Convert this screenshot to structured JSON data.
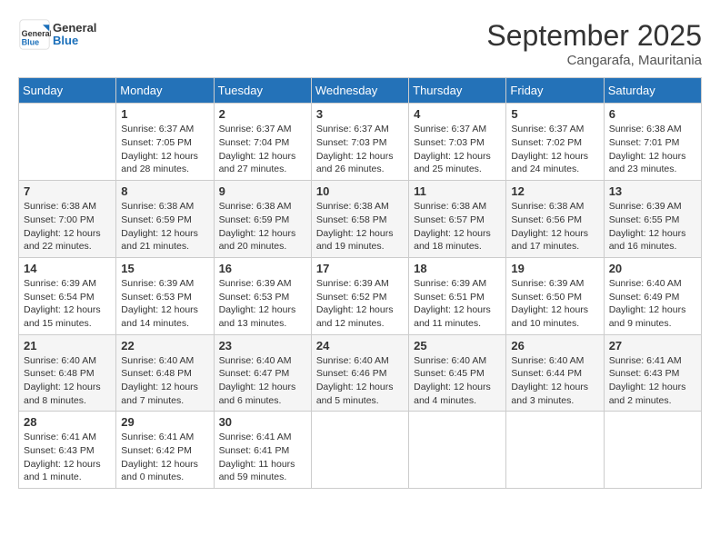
{
  "header": {
    "logo_general": "General",
    "logo_blue": "Blue",
    "month_year": "September 2025",
    "location": "Cangarafa, Mauritania"
  },
  "days_of_week": [
    "Sunday",
    "Monday",
    "Tuesday",
    "Wednesday",
    "Thursday",
    "Friday",
    "Saturday"
  ],
  "weeks": [
    [
      {
        "day": "",
        "info": ""
      },
      {
        "day": "1",
        "info": "Sunrise: 6:37 AM\nSunset: 7:05 PM\nDaylight: 12 hours\nand 28 minutes."
      },
      {
        "day": "2",
        "info": "Sunrise: 6:37 AM\nSunset: 7:04 PM\nDaylight: 12 hours\nand 27 minutes."
      },
      {
        "day": "3",
        "info": "Sunrise: 6:37 AM\nSunset: 7:03 PM\nDaylight: 12 hours\nand 26 minutes."
      },
      {
        "day": "4",
        "info": "Sunrise: 6:37 AM\nSunset: 7:03 PM\nDaylight: 12 hours\nand 25 minutes."
      },
      {
        "day": "5",
        "info": "Sunrise: 6:37 AM\nSunset: 7:02 PM\nDaylight: 12 hours\nand 24 minutes."
      },
      {
        "day": "6",
        "info": "Sunrise: 6:38 AM\nSunset: 7:01 PM\nDaylight: 12 hours\nand 23 minutes."
      }
    ],
    [
      {
        "day": "7",
        "info": "Sunrise: 6:38 AM\nSunset: 7:00 PM\nDaylight: 12 hours\nand 22 minutes."
      },
      {
        "day": "8",
        "info": "Sunrise: 6:38 AM\nSunset: 6:59 PM\nDaylight: 12 hours\nand 21 minutes."
      },
      {
        "day": "9",
        "info": "Sunrise: 6:38 AM\nSunset: 6:59 PM\nDaylight: 12 hours\nand 20 minutes."
      },
      {
        "day": "10",
        "info": "Sunrise: 6:38 AM\nSunset: 6:58 PM\nDaylight: 12 hours\nand 19 minutes."
      },
      {
        "day": "11",
        "info": "Sunrise: 6:38 AM\nSunset: 6:57 PM\nDaylight: 12 hours\nand 18 minutes."
      },
      {
        "day": "12",
        "info": "Sunrise: 6:38 AM\nSunset: 6:56 PM\nDaylight: 12 hours\nand 17 minutes."
      },
      {
        "day": "13",
        "info": "Sunrise: 6:39 AM\nSunset: 6:55 PM\nDaylight: 12 hours\nand 16 minutes."
      }
    ],
    [
      {
        "day": "14",
        "info": "Sunrise: 6:39 AM\nSunset: 6:54 PM\nDaylight: 12 hours\nand 15 minutes."
      },
      {
        "day": "15",
        "info": "Sunrise: 6:39 AM\nSunset: 6:53 PM\nDaylight: 12 hours\nand 14 minutes."
      },
      {
        "day": "16",
        "info": "Sunrise: 6:39 AM\nSunset: 6:53 PM\nDaylight: 12 hours\nand 13 minutes."
      },
      {
        "day": "17",
        "info": "Sunrise: 6:39 AM\nSunset: 6:52 PM\nDaylight: 12 hours\nand 12 minutes."
      },
      {
        "day": "18",
        "info": "Sunrise: 6:39 AM\nSunset: 6:51 PM\nDaylight: 12 hours\nand 11 minutes."
      },
      {
        "day": "19",
        "info": "Sunrise: 6:39 AM\nSunset: 6:50 PM\nDaylight: 12 hours\nand 10 minutes."
      },
      {
        "day": "20",
        "info": "Sunrise: 6:40 AM\nSunset: 6:49 PM\nDaylight: 12 hours\nand 9 minutes."
      }
    ],
    [
      {
        "day": "21",
        "info": "Sunrise: 6:40 AM\nSunset: 6:48 PM\nDaylight: 12 hours\nand 8 minutes."
      },
      {
        "day": "22",
        "info": "Sunrise: 6:40 AM\nSunset: 6:48 PM\nDaylight: 12 hours\nand 7 minutes."
      },
      {
        "day": "23",
        "info": "Sunrise: 6:40 AM\nSunset: 6:47 PM\nDaylight: 12 hours\nand 6 minutes."
      },
      {
        "day": "24",
        "info": "Sunrise: 6:40 AM\nSunset: 6:46 PM\nDaylight: 12 hours\nand 5 minutes."
      },
      {
        "day": "25",
        "info": "Sunrise: 6:40 AM\nSunset: 6:45 PM\nDaylight: 12 hours\nand 4 minutes."
      },
      {
        "day": "26",
        "info": "Sunrise: 6:40 AM\nSunset: 6:44 PM\nDaylight: 12 hours\nand 3 minutes."
      },
      {
        "day": "27",
        "info": "Sunrise: 6:41 AM\nSunset: 6:43 PM\nDaylight: 12 hours\nand 2 minutes."
      }
    ],
    [
      {
        "day": "28",
        "info": "Sunrise: 6:41 AM\nSunset: 6:43 PM\nDaylight: 12 hours\nand 1 minute."
      },
      {
        "day": "29",
        "info": "Sunrise: 6:41 AM\nSunset: 6:42 PM\nDaylight: 12 hours\nand 0 minutes."
      },
      {
        "day": "30",
        "info": "Sunrise: 6:41 AM\nSunset: 6:41 PM\nDaylight: 11 hours\nand 59 minutes."
      },
      {
        "day": "",
        "info": ""
      },
      {
        "day": "",
        "info": ""
      },
      {
        "day": "",
        "info": ""
      },
      {
        "day": "",
        "info": ""
      }
    ]
  ]
}
